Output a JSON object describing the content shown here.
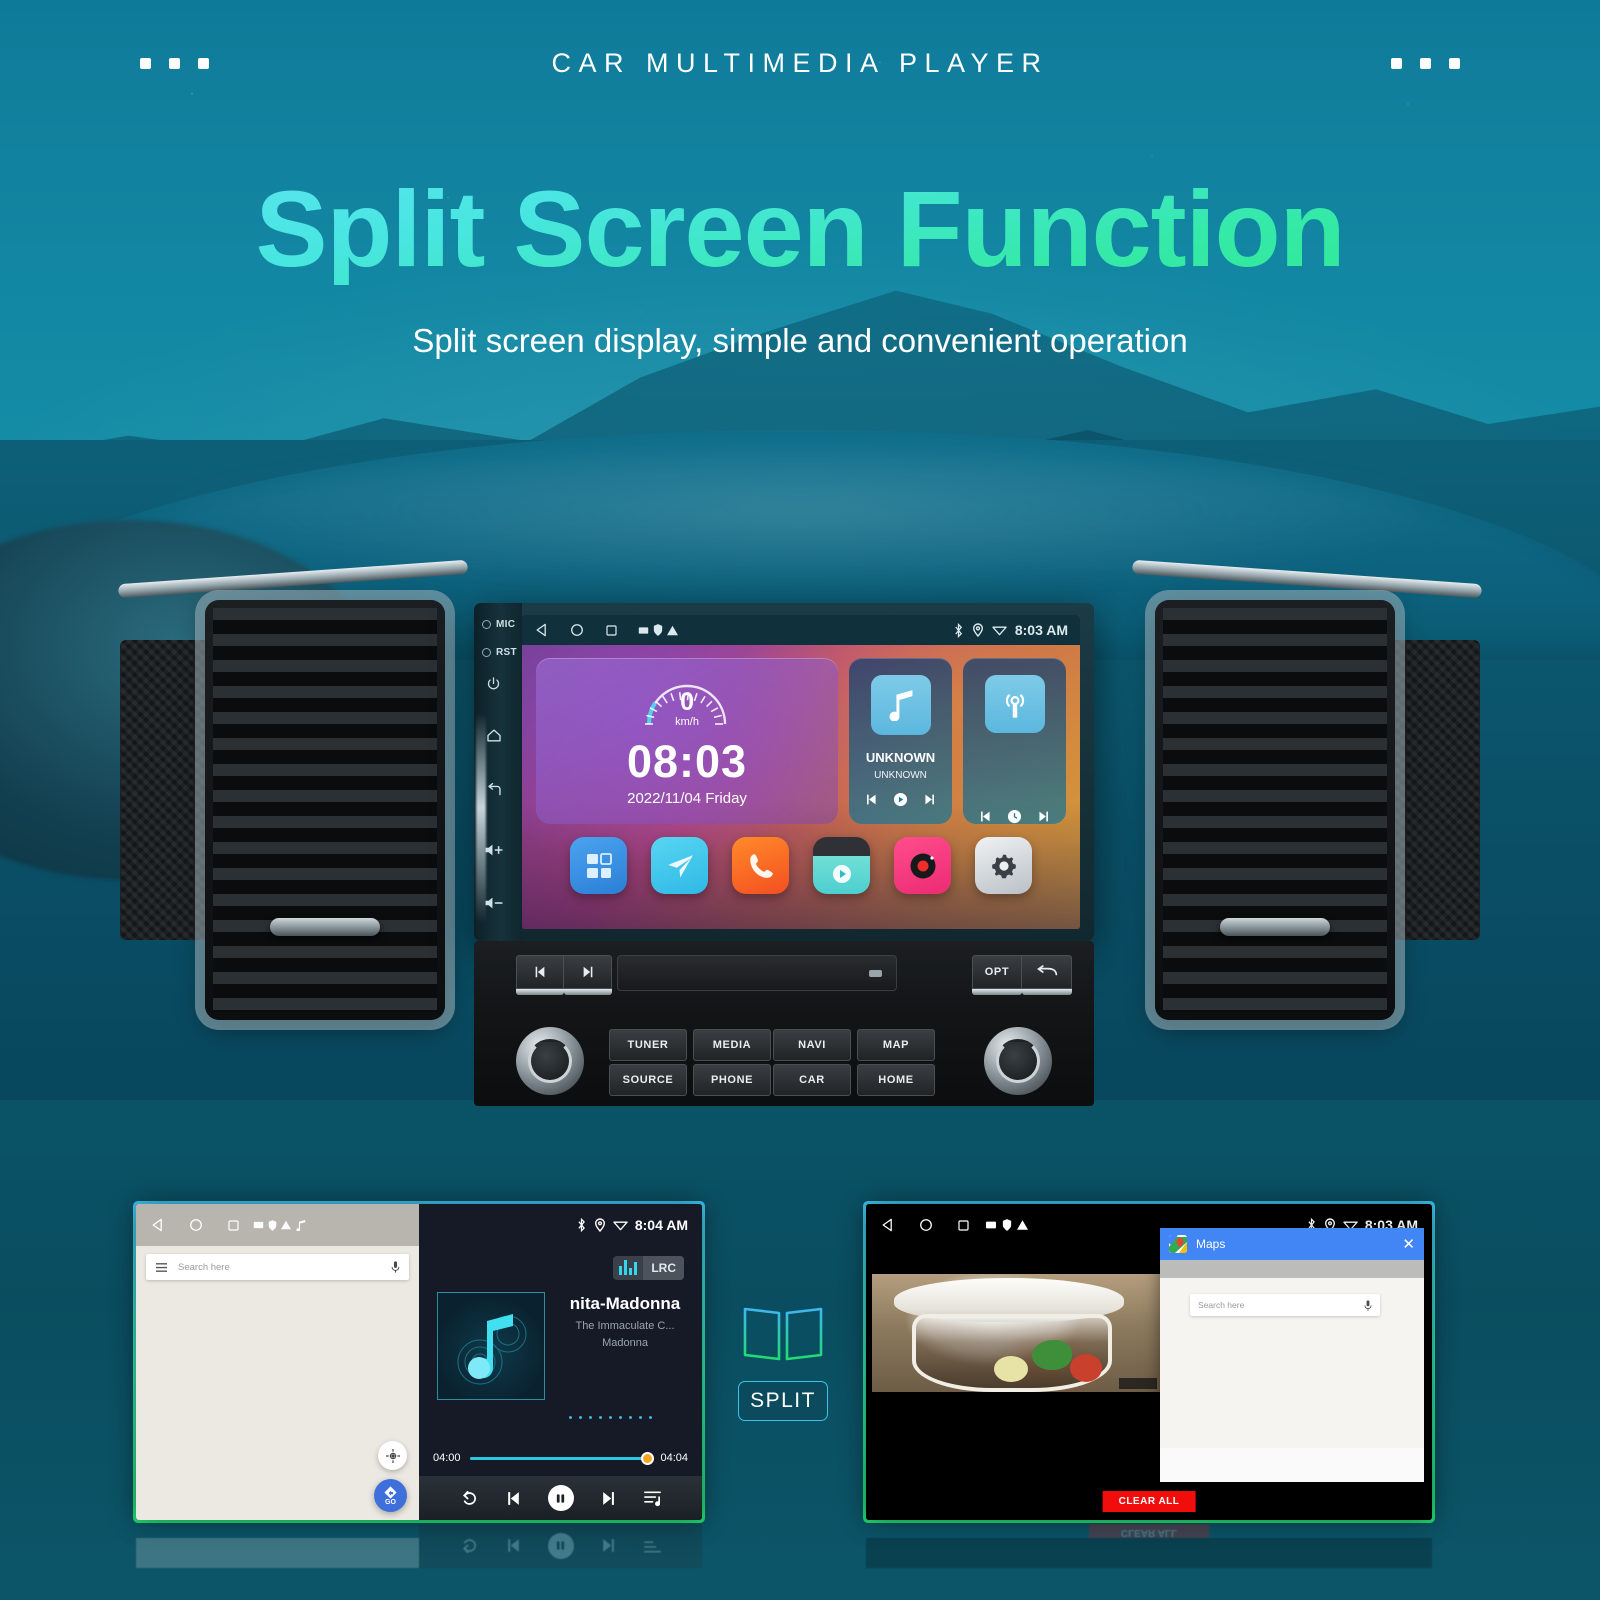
{
  "header": {
    "kicker": "CAR MULTIMEDIA PLAYER",
    "title": "Split Screen Function",
    "subtitle": "Split screen display, simple and convenient operation",
    "dots_left": [
      "dot",
      "dot",
      "dot"
    ],
    "dots_right": [
      "dot",
      "dot",
      "dot"
    ]
  },
  "colors": {
    "brand_cyan": "#3fc4f0",
    "brand_green": "#21dc6f",
    "accent_orange": "#f5a623",
    "maps_blue": "#4285f4",
    "danger_red": "#f20d0d",
    "background_teal": "#0b5a72"
  },
  "head_unit": {
    "side_buttons": [
      {
        "label": "MIC",
        "type": "led"
      },
      {
        "label": "RST",
        "type": "led"
      },
      {
        "label": "",
        "type": "power-icon"
      },
      {
        "label": "",
        "type": "home-icon"
      },
      {
        "label": "",
        "type": "back-icon"
      },
      {
        "label": "",
        "type": "volume-up-icon"
      },
      {
        "label": "",
        "type": "volume-down-icon"
      }
    ],
    "status_bar": {
      "nav_icons": [
        "back-triangle-icon",
        "home-circle-icon",
        "recents-square-icon",
        "image-icon",
        "shield-icon",
        "warning-icon"
      ],
      "tray_icons": [
        "bluetooth-icon",
        "location-icon",
        "wifi-icon"
      ],
      "time": "8:03 AM"
    },
    "clock_widget": {
      "speed_value": "0",
      "speed_unit": "km/h",
      "time": "08:03",
      "date": "2022/11/04  Friday"
    },
    "cards": [
      {
        "icon": "music-note-icon",
        "title": "UNKNOWN",
        "subtitle": "UNKNOWN",
        "controls": [
          "prev-icon",
          "play-icon",
          "next-icon"
        ]
      },
      {
        "icon": "radio-signal-icon",
        "title": "",
        "subtitle": "",
        "controls": [
          "prev-icon",
          "scan-icon",
          "next-icon"
        ]
      }
    ],
    "dock_apps": [
      {
        "name": "apps-grid-icon"
      },
      {
        "name": "navigation-send-icon"
      },
      {
        "name": "phone-icon"
      },
      {
        "name": "video-clapper-icon"
      },
      {
        "name": "radio-record-icon"
      },
      {
        "name": "settings-gear-icon"
      }
    ]
  },
  "radio_panel": {
    "transport": [
      "prev-track-icon",
      "next-track-icon"
    ],
    "right_buttons": [
      {
        "label": "OPT"
      },
      {
        "label": "",
        "icon": "return-arrow-icon"
      }
    ],
    "buttons_row1": [
      "TUNER",
      "MEDIA",
      "NAVI",
      "MAP"
    ],
    "buttons_row2": [
      "SOURCE",
      "PHONE",
      "CAR",
      "HOME"
    ],
    "knobs": [
      "volume-knob-left",
      "tune-knob-right"
    ]
  },
  "split_badge": {
    "icon": "split-screen-icon",
    "label": "SPLIT"
  },
  "panel_left": {
    "status_bar": {
      "nav_icons": [
        "back-triangle-icon",
        "home-circle-icon",
        "recents-square-icon",
        "image-icon",
        "shield-icon",
        "warning-icon",
        "music-note-icon"
      ],
      "tray_icons": [
        "bluetooth-icon",
        "location-icon",
        "wifi-icon"
      ],
      "time": "8:04 AM"
    },
    "maps": {
      "menu_icon": "hamburger-menu-icon",
      "search_placeholder": "Search here",
      "mic_icon": "microphone-icon",
      "locate_icon": "my-location-icon",
      "go_button": {
        "icon": "navigate-icon",
        "label": "GO"
      }
    },
    "music": {
      "lrc_badge": {
        "eq_icon": "equalizer-icon",
        "label": "LRC"
      },
      "album_art": "music-note-artwork",
      "title": "nita-Madonna",
      "album": "The Immaculate C...",
      "artist": "Madonna",
      "elapsed": "04:00",
      "duration": "04:04",
      "progress_percent": 95,
      "controls": [
        "repeat-icon",
        "previous-icon",
        "pause-icon",
        "next-icon",
        "playlist-icon"
      ]
    }
  },
  "panel_right": {
    "status_bar": {
      "nav_icons": [
        "back-triangle-icon",
        "home-circle-icon",
        "recents-square-icon",
        "image-icon",
        "shield-icon",
        "warning-icon"
      ],
      "tray_icons": [
        "bluetooth-icon",
        "location-icon",
        "wifi-icon"
      ],
      "time": "8:03 AM"
    },
    "video": {
      "content": "cooking-pot-video-thumbnail"
    },
    "maps_window": {
      "app_icon": "google-maps-icon",
      "title": "Maps",
      "close_icon": "close-x-icon",
      "search_placeholder": "Search here",
      "mic_icon": "microphone-icon"
    },
    "clear_all_label": "CLEAR ALL"
  }
}
